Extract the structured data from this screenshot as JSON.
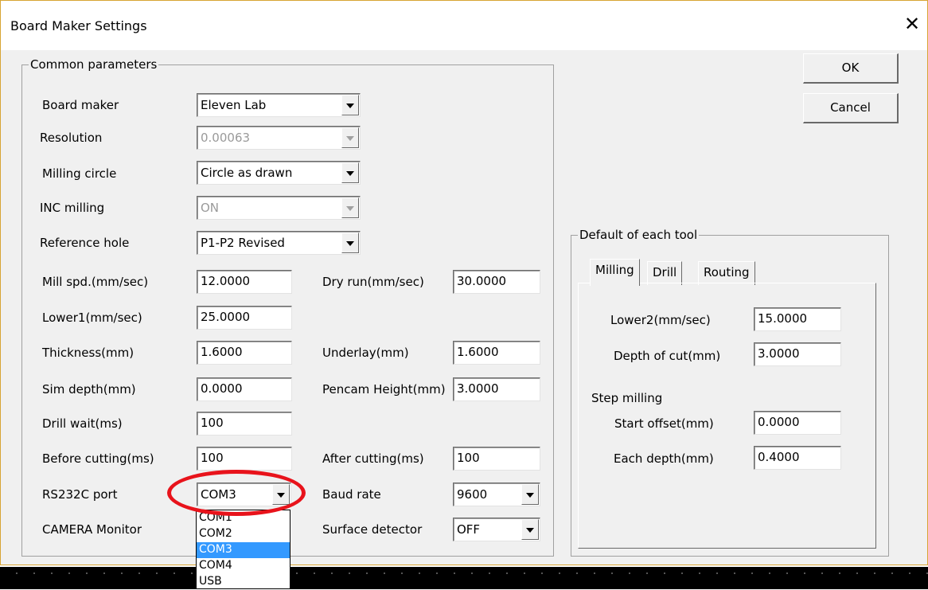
{
  "window": {
    "title": "Board Maker Settings",
    "close_symbol": "✕"
  },
  "buttons": {
    "ok": "OK",
    "cancel": "Cancel"
  },
  "common": {
    "group_title": "Common parameters",
    "board_maker": {
      "label": "Board maker",
      "value": "Eleven Lab"
    },
    "resolution": {
      "label": "Resolution",
      "value": "0.00063"
    },
    "milling_circle": {
      "label": "Milling circle",
      "value": "Circle as drawn"
    },
    "inc_milling": {
      "label": "INC milling",
      "value": "ON"
    },
    "reference_hole": {
      "label": "Reference hole",
      "value": "P1-P2 Revised"
    },
    "mill_spd": {
      "label": "Mill spd.(mm/sec)",
      "value": "12.0000"
    },
    "dry_run": {
      "label": "Dry run(mm/sec)",
      "value": "30.0000"
    },
    "lower1": {
      "label": "Lower1(mm/sec)",
      "value": "25.0000"
    },
    "thickness": {
      "label": "Thickness(mm)",
      "value": "1.6000"
    },
    "underlay": {
      "label": "Underlay(mm)",
      "value": "1.6000"
    },
    "sim_depth": {
      "label": "Sim depth(mm)",
      "value": "0.0000"
    },
    "pencam_height": {
      "label": "Pencam Height(mm)",
      "value": "3.0000"
    },
    "drill_wait": {
      "label": "Drill wait(ms)",
      "value": "100"
    },
    "before_cutting": {
      "label": "Before cutting(ms)",
      "value": "100"
    },
    "after_cutting": {
      "label": "After cutting(ms)",
      "value": "100"
    },
    "rs232c_port": {
      "label": "RS232C port",
      "value": "COM3"
    },
    "baud_rate": {
      "label": "Baud rate",
      "value": "9600"
    },
    "camera_monitor": {
      "label": "CAMERA Monitor"
    },
    "surface_detector": {
      "label": "Surface detector",
      "value": "OFF"
    }
  },
  "port_dropdown": {
    "options": [
      "COM1",
      "COM2",
      "COM3",
      "COM4",
      "USB"
    ],
    "selected": "COM3"
  },
  "tool_defaults": {
    "group_title": "Default of each tool",
    "tabs": [
      "Milling",
      "Drill",
      "Routing"
    ],
    "active_tab": "Milling",
    "lower2": {
      "label": "Lower2(mm/sec)",
      "value": "15.0000"
    },
    "depth_of_cut": {
      "label": "Depth of cut(mm)",
      "value": "3.0000"
    },
    "step_milling_title": "Step milling",
    "start_offset": {
      "label": "Start offset(mm)",
      "value": "0.0000"
    },
    "each_depth": {
      "label": "Each depth(mm)",
      "value": "0.4000"
    }
  },
  "colors": {
    "highlight": "#e8131b",
    "selection": "#3399ff",
    "dialog_bg": "#f0f0f0"
  }
}
